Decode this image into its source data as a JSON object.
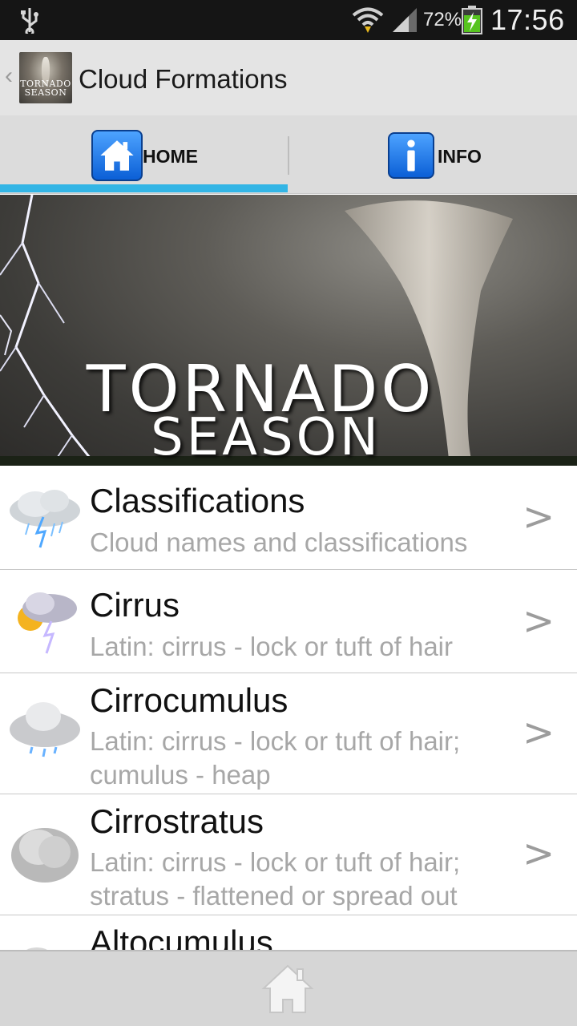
{
  "status_bar": {
    "battery_percent": "72%",
    "time": "17:56"
  },
  "action_bar": {
    "title": "Cloud Formations",
    "icon_text_line1": "TORNADO",
    "icon_text_line2": "SEASON"
  },
  "tabs": [
    {
      "label": "HOME",
      "selected": true
    },
    {
      "label": "INFO",
      "selected": false
    }
  ],
  "banner": {
    "line1": "TORNADO",
    "line2": "SEASON"
  },
  "list": [
    {
      "name": "Classifications",
      "desc": "Cloud names and classifications",
      "icon": "storm-cloud-icon"
    },
    {
      "name": "Cirrus",
      "desc": "Latin: cirrus - lock or tuft of hair",
      "icon": "sun-lightning-cloud-icon"
    },
    {
      "name": "Cirrocumulus",
      "desc": "Latin: cirrus - lock or tuft of hair; cumulus - heap",
      "icon": "rain-cloud-icon"
    },
    {
      "name": "Cirrostratus",
      "desc": "Latin: cirrus - lock or tuft of hair; stratus - flattened or spread out",
      "icon": "grey-cloud-icon"
    },
    {
      "name": "Altocumulus",
      "desc": "",
      "icon": "cloud-icon"
    }
  ],
  "chevron": ">",
  "colors": {
    "accent": "#33b5e5",
    "status_bar": "#151515",
    "action_bar": "#e4e4e4",
    "tab_bar": "#dcdcdc",
    "desc_text": "#a7a7a7"
  }
}
